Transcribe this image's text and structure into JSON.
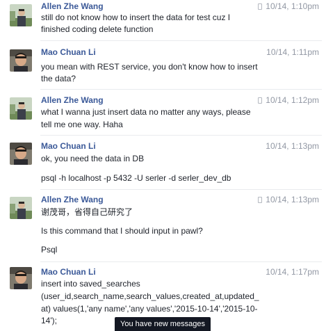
{
  "messages": [
    {
      "author": "Allen Zhe Wang",
      "time": "10/14, 1:10pm",
      "lines": [
        "still do not know how to insert the data for test cuz I",
        "finished coding delete function"
      ]
    },
    {
      "author": "Mao Chuan Li",
      "time": "10/14, 1:11pm",
      "lines": [
        "you mean with REST service, you don't know how to insert",
        "the data?"
      ]
    },
    {
      "author": "Allen Zhe Wang",
      "time": "10/14, 1:12pm",
      "lines": [
        "what I wanna just insert data no matter any ways, please",
        "tell me one way. Haha"
      ]
    },
    {
      "author": "Mao Chuan Li",
      "time": "10/14, 1:13pm",
      "lines": [
        "ok, you need the data in DB",
        "psql -h localhost -p 5432 -U serler -d serler_dev_db"
      ]
    },
    {
      "author": "Allen Zhe Wang",
      "time": "10/14, 1:13pm",
      "lines": [
        "谢茂哥，省得自己研究了",
        "Is this command that I should input in pawl?",
        "Psql"
      ]
    },
    {
      "author": "Mao Chuan Li",
      "time": "10/14, 1:17pm",
      "lines": [
        "insert into saved_searches",
        "(user_id,search_name,search_values,created_at,updated_",
        "at) values(1,'any name','any values','2015-10-14','2015-10-",
        "14');"
      ]
    }
  ],
  "toast": "You have new messages",
  "icons": {
    "mobile": "mobile-phone-icon",
    "avatar_allen": "profile-photo-outdoor",
    "avatar_mao": "profile-photo-portrait"
  },
  "colors": {
    "author_name": "#3b5998",
    "timestamp": "#9197a3",
    "message_text": "#1d2129",
    "toast_bg": "#141823"
  }
}
